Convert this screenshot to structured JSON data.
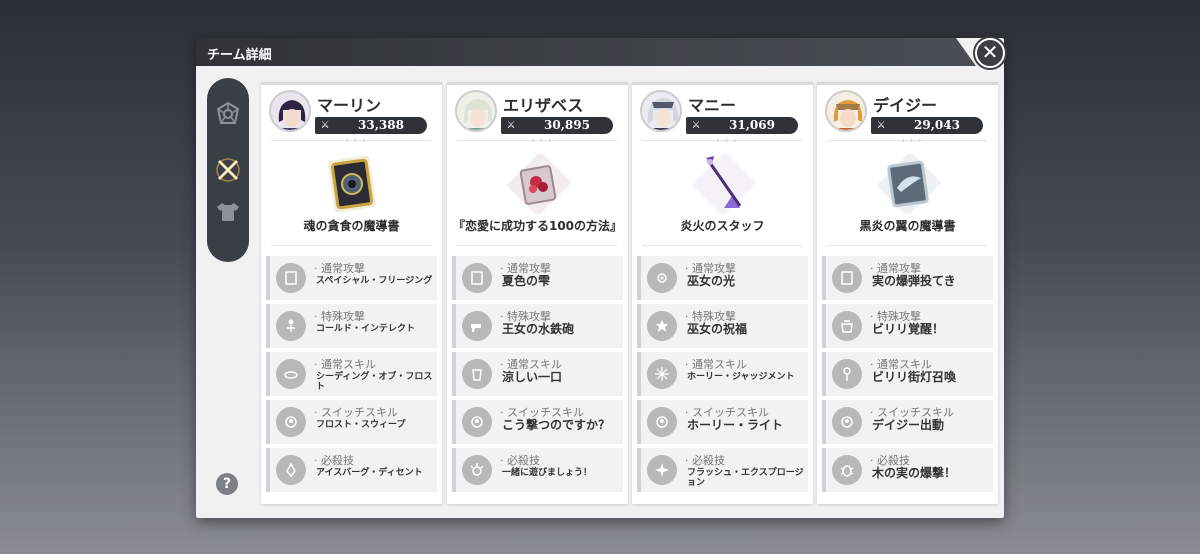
{
  "window": {
    "title": "チーム詳細",
    "close_icon": "close-icon",
    "help_label": "?"
  },
  "sidebar": {
    "items": [
      {
        "icon": "team-emblem-icon",
        "selected": false
      },
      {
        "icon": "weapon-icon",
        "selected": true
      },
      {
        "icon": "armor-icon",
        "selected": false
      }
    ]
  },
  "characters": [
    {
      "name": "マーリン",
      "power": "33,388",
      "weapon": "魂の貪食の魔導書",
      "skills": [
        {
          "type": "· 通常攻撃",
          "name": "スペイシャル・フリージング"
        },
        {
          "type": "· 特殊攻撃",
          "name": "コールド・インテレクト"
        },
        {
          "type": "· 通常スキル",
          "name": "シーディング・オブ・フロスト"
        },
        {
          "type": "· スイッチスキル",
          "name": "フロスト・スウィープ"
        },
        {
          "type": "· 必殺技",
          "name": "アイスバーグ・ディセント"
        }
      ]
    },
    {
      "name": "エリザベス",
      "power": "30,895",
      "weapon": "『恋愛に成功する100の方法』",
      "skills": [
        {
          "type": "· 通常攻撃",
          "name": "夏色の雫"
        },
        {
          "type": "· 特殊攻撃",
          "name": "王女の水鉄砲"
        },
        {
          "type": "· 通常スキル",
          "name": "涼しい一口"
        },
        {
          "type": "· スイッチスキル",
          "name": "こう撃つのですか？"
        },
        {
          "type": "· 必殺技",
          "name": "一緒に遊びましょう！"
        }
      ]
    },
    {
      "name": "マニー",
      "power": "31,069",
      "weapon": "炎火のスタッフ",
      "skills": [
        {
          "type": "· 通常攻撃",
          "name": "巫女の光"
        },
        {
          "type": "· 特殊攻撃",
          "name": "巫女の祝福"
        },
        {
          "type": "· 通常スキル",
          "name": "ホーリー・ジャッジメント"
        },
        {
          "type": "· スイッチスキル",
          "name": "ホーリー・ライト"
        },
        {
          "type": "· 必殺技",
          "name": "フラッシュ・エクスプロージョン"
        }
      ]
    },
    {
      "name": "デイジー",
      "power": "29,043",
      "weapon": "黒炎の翼の魔導書",
      "skills": [
        {
          "type": "· 通常攻撃",
          "name": "実の爆弾投てき"
        },
        {
          "type": "· 特殊攻撃",
          "name": "ビリリ覚醒！"
        },
        {
          "type": "· 通常スキル",
          "name": "ビリリ街灯召喚"
        },
        {
          "type": "· スイッチスキル",
          "name": "デイジー出動"
        },
        {
          "type": "· 必殺技",
          "name": "木の実の爆撃！"
        }
      ]
    }
  ]
}
